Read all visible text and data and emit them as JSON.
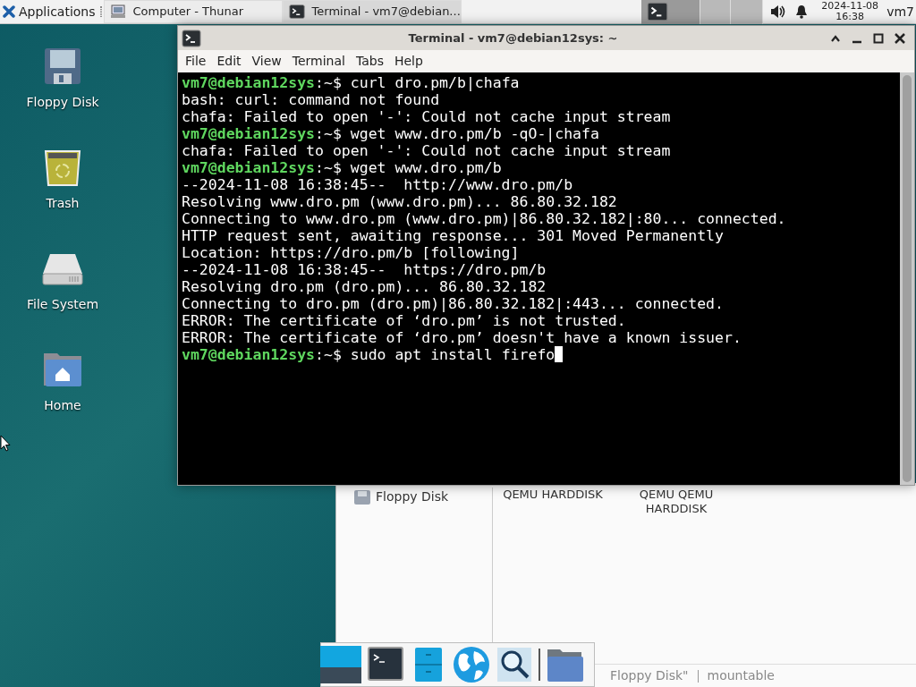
{
  "panel": {
    "apps_menu": "Applications",
    "tasks": [
      {
        "label": "Computer - Thunar",
        "kind": "computer",
        "selected": false
      },
      {
        "label": "Terminal - vm7@debian...",
        "kind": "terminal",
        "selected": true
      }
    ],
    "workspaces": [
      {
        "selected": true
      },
      {
        "selected": false
      },
      {
        "selected": false
      }
    ],
    "clock": {
      "date": "2024-11-08",
      "time": "16:38"
    },
    "user": "vm7"
  },
  "desktop_icons": [
    {
      "label": "Floppy Disk",
      "kind": "floppy"
    },
    {
      "label": "Trash",
      "kind": "trash"
    },
    {
      "label": "File System",
      "kind": "drive"
    },
    {
      "label": "Home",
      "kind": "home"
    }
  ],
  "terminal": {
    "title": "Terminal - vm7@debian12sys: ~",
    "menu": [
      "File",
      "Edit",
      "View",
      "Terminal",
      "Tabs",
      "Help"
    ],
    "cursor": true,
    "lines": [
      {
        "kind": "prompt",
        "user": "vm7@debian12sys",
        "path": ":~$ ",
        "command": "curl dro.pm/b|chafa"
      },
      {
        "kind": "output",
        "text": "bash: curl: command not found"
      },
      {
        "kind": "output",
        "text": "chafa: Failed to open '-': Could not cache input stream"
      },
      {
        "kind": "prompt",
        "user": "vm7@debian12sys",
        "path": ":~$ ",
        "command": "wget www.dro.pm/b -qO-|chafa"
      },
      {
        "kind": "output",
        "text": "chafa: Failed to open '-': Could not cache input stream"
      },
      {
        "kind": "prompt",
        "user": "vm7@debian12sys",
        "path": ":~$ ",
        "command": "wget www.dro.pm/b"
      },
      {
        "kind": "output",
        "text": "--2024-11-08 16:38:45--  http://www.dro.pm/b"
      },
      {
        "kind": "output",
        "text": "Resolving www.dro.pm (www.dro.pm)... 86.80.32.182"
      },
      {
        "kind": "output",
        "text": "Connecting to www.dro.pm (www.dro.pm)|86.80.32.182|:80... connected."
      },
      {
        "kind": "output",
        "text": "HTTP request sent, awaiting response... 301 Moved Permanently"
      },
      {
        "kind": "output",
        "text": "Location: https://dro.pm/b [following]"
      },
      {
        "kind": "output",
        "text": "--2024-11-08 16:38:45--  https://dro.pm/b"
      },
      {
        "kind": "output",
        "text": "Resolving dro.pm (dro.pm)... 86.80.32.182"
      },
      {
        "kind": "output",
        "text": "Connecting to dro.pm (dro.pm)|86.80.32.182|:443... connected."
      },
      {
        "kind": "output",
        "text": "ERROR: The certificate of ‘dro.pm’ is not trusted."
      },
      {
        "kind": "output",
        "text": "ERROR: The certificate of ‘dro.pm’ doesn't have a known issuer."
      },
      {
        "kind": "prompt",
        "user": "vm7@debian12sys",
        "path": ":~$ ",
        "command": "sudo apt install firefo"
      }
    ]
  },
  "thunar": {
    "sidebar_items": [
      {
        "label": "Floppy Disk"
      }
    ],
    "devices": [
      {
        "label": "QEMU HARDDISK"
      },
      {
        "label": "QEMU QEMU HARDDISK"
      }
    ],
    "status": [
      "Floppy Disk\"",
      "mountable"
    ]
  },
  "dock": {
    "items": [
      {
        "kind": "tile"
      },
      {
        "kind": "terminal"
      },
      {
        "kind": "cabinet"
      },
      {
        "kind": "globe"
      },
      {
        "kind": "search"
      },
      {
        "kind": "separator"
      },
      {
        "kind": "folder"
      }
    ]
  }
}
